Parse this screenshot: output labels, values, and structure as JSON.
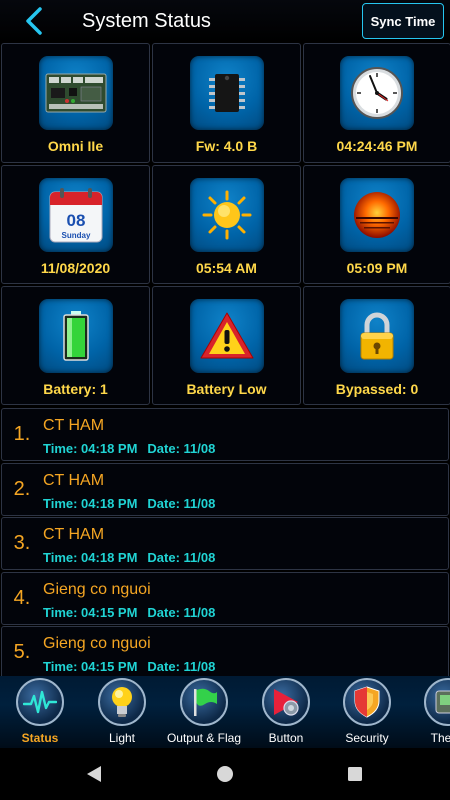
{
  "header": {
    "title": "System Status",
    "sync_label": "Sync Time"
  },
  "tiles": [
    {
      "label": "Omni IIe",
      "icon": "controller-board-icon"
    },
    {
      "label": "Fw: 4.0 B",
      "icon": "chip-icon"
    },
    {
      "label": "04:24:46 PM",
      "icon": "clock-icon"
    },
    {
      "label": "11/08/2020",
      "icon": "calendar-icon",
      "calendar_day": "08",
      "calendar_weekday": "Sunday"
    },
    {
      "label": "05:54 AM",
      "icon": "sunrise-icon"
    },
    {
      "label": "05:09 PM",
      "icon": "sunset-icon"
    },
    {
      "label": "Battery:  1",
      "icon": "battery-icon"
    },
    {
      "label": "Battery Low",
      "icon": "warning-icon"
    },
    {
      "label": "Bypassed: 0",
      "icon": "padlock-icon"
    }
  ],
  "events": [
    {
      "num": "1.",
      "name": "CT HAM",
      "time": "Time: 04:18 PM",
      "date": "Date: 11/08"
    },
    {
      "num": "2.",
      "name": "CT HAM",
      "time": "Time: 04:18 PM",
      "date": "Date: 11/08"
    },
    {
      "num": "3.",
      "name": "CT HAM",
      "time": "Time: 04:18 PM",
      "date": "Date: 11/08"
    },
    {
      "num": "4.",
      "name": "Gieng co nguoi",
      "time": "Time: 04:15 PM",
      "date": "Date: 11/08"
    },
    {
      "num": "5.",
      "name": "Gieng co nguoi",
      "time": "Time: 04:15 PM",
      "date": "Date: 11/08"
    }
  ],
  "tabs": [
    {
      "label": "Status",
      "icon": "pulse-icon",
      "active": true
    },
    {
      "label": "Light",
      "icon": "bulb-icon"
    },
    {
      "label": "Output & Flag",
      "icon": "flag-icon"
    },
    {
      "label": "Button",
      "icon": "button-icon"
    },
    {
      "label": "Security",
      "icon": "shield-icon"
    },
    {
      "label": "Therm",
      "icon": "thermostat-icon"
    }
  ],
  "colors": {
    "accent": "#f5a623",
    "label": "#ffd84a",
    "meta": "#20d4d4",
    "border": "#26c6f0"
  }
}
